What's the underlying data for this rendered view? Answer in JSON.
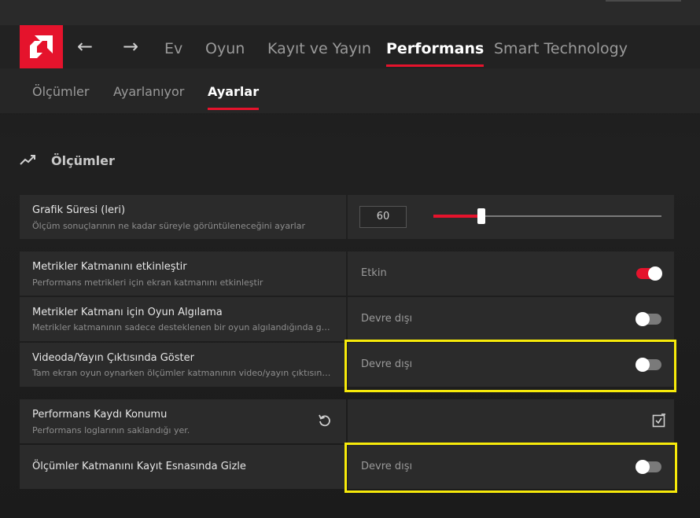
{
  "nav": {
    "back_symbol": "←",
    "forward_symbol": "→",
    "tabs": [
      {
        "label": "Ev"
      },
      {
        "label": "Oyun"
      },
      {
        "label": "Kayıt ve Yayın"
      },
      {
        "label": "Performans"
      },
      {
        "label": "Smart Technology"
      }
    ],
    "active_tab": "Performans"
  },
  "subnav": {
    "tabs": [
      {
        "label": "Ölçümler"
      },
      {
        "label": "Ayarlanıyor"
      },
      {
        "label": "Ayarlar"
      }
    ],
    "active_tab": "Ayarlar"
  },
  "section": {
    "title": "Ölçümler",
    "icon": "trending-up-icon"
  },
  "rows": {
    "graph_duration": {
      "title": "Grafik Süresi (leri)",
      "desc": "Ölçüm sonuçlarının ne kadar süreyle görüntüleneceğini ayarlar",
      "value": "60",
      "slider_level": 0.21
    },
    "enable_overlay": {
      "title": "Metrikler Katmanını etkinleştir",
      "desc": "Performans metrikleri için ekran katmanını etkinleştir",
      "state_label": "Etkin",
      "on": true
    },
    "game_detect": {
      "title": "Metrikler Katmanı için Oyun Algılama",
      "desc": "Metrikler katmanının sadece desteklenen bir oyun algılandığında görün...",
      "state_label": "Devre dışı",
      "on": false
    },
    "show_in_video": {
      "title": "Videoda/Yayın Çıktısında Göster",
      "desc": "Tam ekran oyun oynarken ölçümler katmanının video/yayın çıktısında g...",
      "state_label": "Devre dışı",
      "on": false
    },
    "log_location": {
      "title": "Performans Kaydı Konumu",
      "desc": "Performans loglarının saklandığı yer."
    },
    "hide_while_recording": {
      "title": "Ölçümler Katmanını Kayıt Esnasında Gizle",
      "state_label": "Devre dışı",
      "on": false
    }
  },
  "colors": {
    "accent": "#e5132c",
    "highlight": "#f7ea0a"
  }
}
